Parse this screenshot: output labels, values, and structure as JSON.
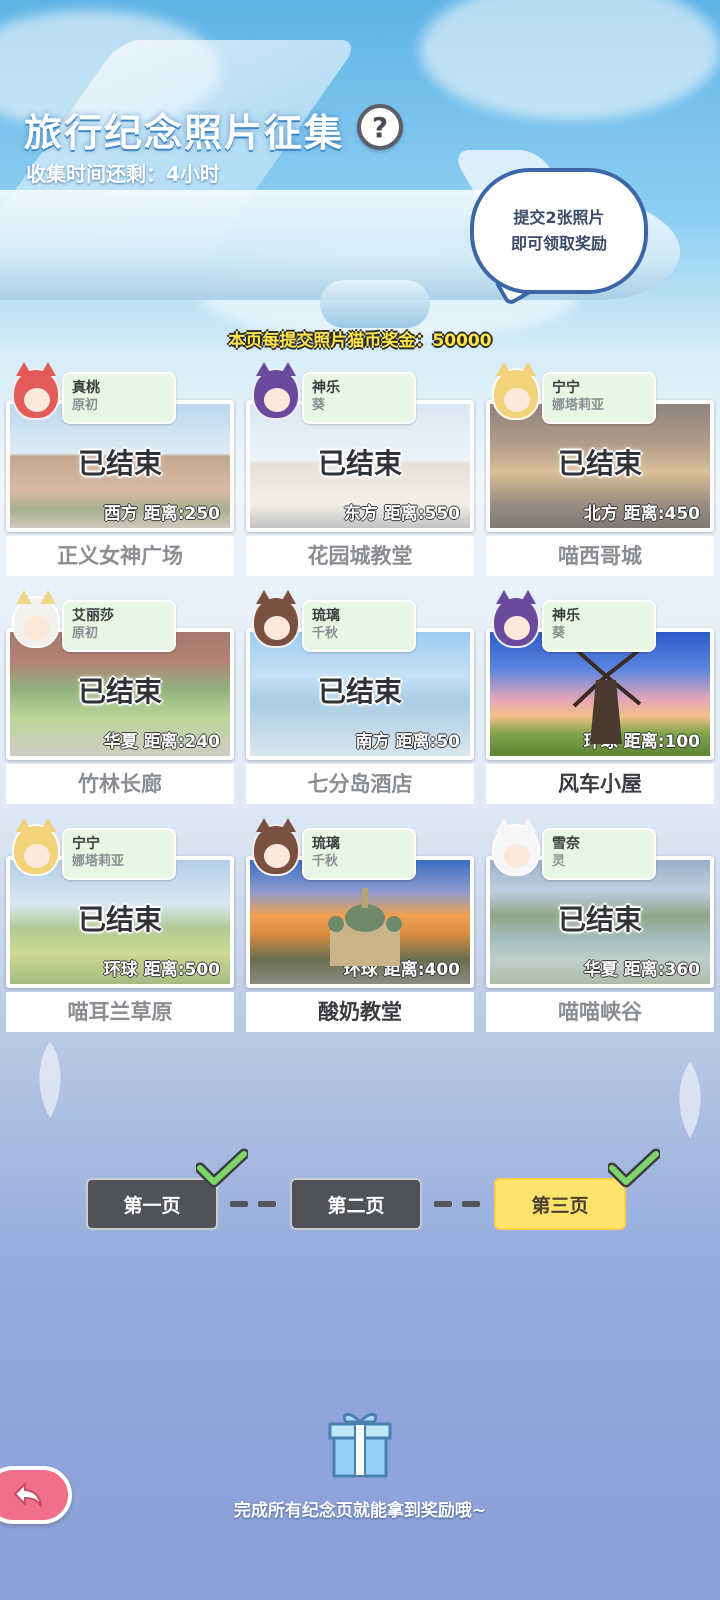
{
  "header": {
    "title": "旅行纪念照片征集",
    "help_icon": "?",
    "timer_text": "收集时间还剩：4小时",
    "bubble_line1": "提交2张照片",
    "bubble_line2": "即可领取奖励",
    "reward_text": "本页每提交照片猫币奖金：50000"
  },
  "cards": [
    {
      "char_name": "真桃",
      "char_sub": "原初",
      "ended": "已结束",
      "distance": "西方  距离:250",
      "place": "正义女神广场",
      "active": false
    },
    {
      "char_name": "神乐",
      "char_sub": "葵",
      "ended": "已结束",
      "distance": "东方  距离:550",
      "place": "花园城教堂",
      "active": false
    },
    {
      "char_name": "宁宁",
      "char_sub": "娜塔莉亚",
      "ended": "已结束",
      "distance": "北方  距离:450",
      "place": "喵西哥城",
      "active": false
    },
    {
      "char_name": "艾丽莎",
      "char_sub": "原初",
      "ended": "已结束",
      "distance": "华夏  距离:240",
      "place": "竹林长廊",
      "active": false
    },
    {
      "char_name": "琉璃",
      "char_sub": "千秋",
      "ended": "已结束",
      "distance": "南方  距离:50",
      "place": "七分岛酒店",
      "active": false
    },
    {
      "char_name": "神乐",
      "char_sub": "葵",
      "ended": "",
      "distance": "环球  距离:100",
      "place": "风车小屋",
      "active": true
    },
    {
      "char_name": "宁宁",
      "char_sub": "娜塔莉亚",
      "ended": "已结束",
      "distance": "环球  距离:500",
      "place": "喵耳兰草原",
      "active": false
    },
    {
      "char_name": "琉璃",
      "char_sub": "千秋",
      "ended": "",
      "distance": "环球  距离:400",
      "place": "酸奶教堂",
      "active": true
    },
    {
      "char_name": "雪奈",
      "char_sub": "灵",
      "ended": "已结束",
      "distance": "华夏  距离:360",
      "place": "喵喵峡谷",
      "active": false
    }
  ],
  "pager": {
    "page1": "第一页",
    "page2": "第二页",
    "page3": "第三页"
  },
  "footer": {
    "complete_text": "完成所有纪念页就能拿到奖励哦~"
  },
  "colors": {
    "current_page": "#fde36c",
    "done_page": "#4f5257",
    "check": "#7fd46a",
    "back_button": "#f0708c"
  }
}
